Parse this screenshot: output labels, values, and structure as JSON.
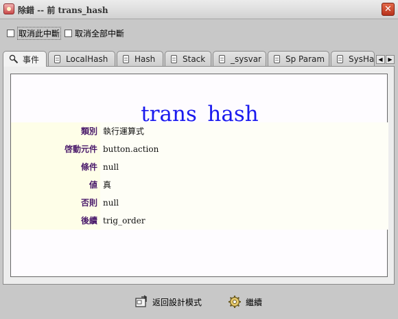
{
  "window": {
    "title": "除錯 -- 前 trans_hash",
    "icon": "debug-app-icon",
    "close_glyph": "✕"
  },
  "options": {
    "cancel_this_break": "取消此中斷",
    "cancel_all_breaks": "取消全部中斷"
  },
  "tabs": [
    {
      "label": "事件",
      "icon": "search-icon",
      "active": true
    },
    {
      "label": "LocalHash",
      "icon": "document-icon"
    },
    {
      "label": "Hash",
      "icon": "document-icon"
    },
    {
      "label": "Stack",
      "icon": "document-icon"
    },
    {
      "label": "_sysvar",
      "icon": "document-icon"
    },
    {
      "label": "Sp Param",
      "icon": "document-icon"
    },
    {
      "label": "SysHa",
      "icon": "document-icon"
    }
  ],
  "tab_scroll": {
    "left": "◀",
    "right": "▶"
  },
  "event": {
    "title": "trans_hash",
    "properties": [
      {
        "key": "類別",
        "value": "執行運算式"
      },
      {
        "key": "啓動元件",
        "value": "button.action"
      },
      {
        "key": "條件",
        "value": "null"
      },
      {
        "key": "値",
        "value": "真"
      },
      {
        "key": "否則",
        "value": "null"
      },
      {
        "key": "後續",
        "value": "trig_order"
      }
    ]
  },
  "actions": {
    "back_to_design": "返回設計模式",
    "continue": "繼續"
  },
  "colors": {
    "heading": "#1a1aee",
    "property_key": "#4a1a6a",
    "property_bg": "#fefee8"
  }
}
